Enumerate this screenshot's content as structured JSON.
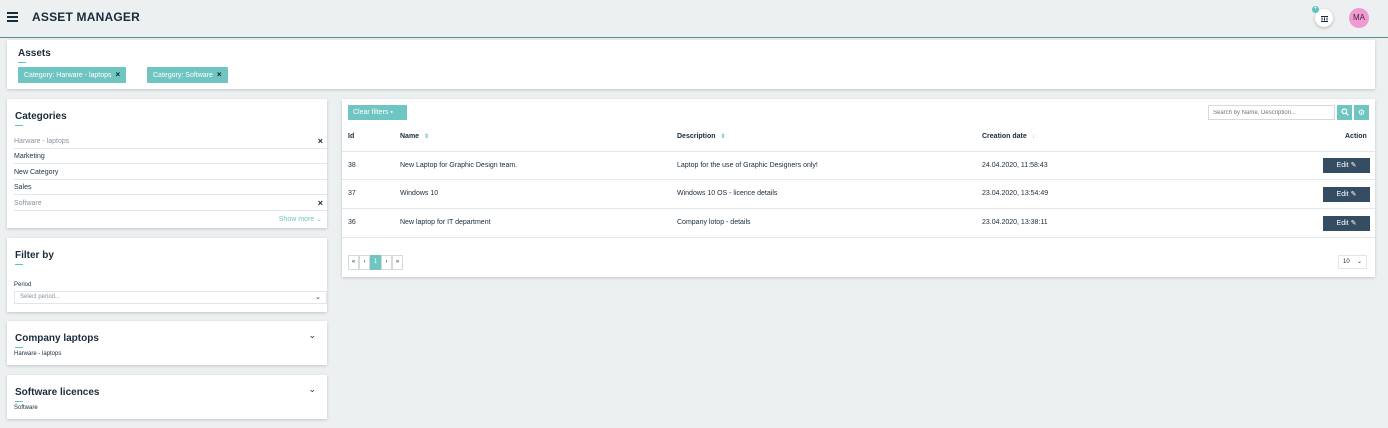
{
  "header": {
    "app_title": "ASSET MANAGER",
    "avatar_initials": "MA",
    "avatar_color": "#ef9bd0",
    "accent_color": "#6fc5c2"
  },
  "assets": {
    "title": "Assets",
    "chips": [
      {
        "label": "Category: Harware - laptops"
      },
      {
        "label": "Category: Software"
      }
    ]
  },
  "categories": {
    "title": "Categories",
    "items": [
      {
        "label": "Harware - laptops",
        "selected": true
      },
      {
        "label": "Marketing",
        "selected": false
      },
      {
        "label": "New Category",
        "selected": false
      },
      {
        "label": "Sales",
        "selected": false
      },
      {
        "label": "Software",
        "selected": true
      }
    ],
    "show_more": "Show more"
  },
  "filter": {
    "title": "Filter by",
    "period_label": "Period",
    "period_placeholder": "Select period..."
  },
  "saved_filters": [
    {
      "title": "Company laptops",
      "subtitle": "Harware - laptops"
    },
    {
      "title": "Software licences",
      "subtitle": "Software"
    }
  ],
  "table": {
    "clear_filters": "Clear filters",
    "search_placeholder": "Search by Name, Description...",
    "columns": {
      "id": "Id",
      "name": "Name",
      "description": "Description",
      "created": "Creation date",
      "action": "Action"
    },
    "rows": [
      {
        "id": "38",
        "name": "New Laptop for Graphic Design team.",
        "description": "Laptop for the use of Graphic Designers only!",
        "created": "24.04.2020, 11:58:43"
      },
      {
        "id": "37",
        "name": "Windows 10",
        "description": "Windows 10 OS - licence details",
        "created": "23.04.2020, 13:54:49"
      },
      {
        "id": "36",
        "name": "New laptop for IT department",
        "description": "Company lotop - details",
        "created": "23.04.2020, 13:38:11"
      }
    ],
    "edit_label": "Edit",
    "pager": {
      "first": "«",
      "prev": "‹",
      "current": "1",
      "next": "›",
      "last": "»"
    },
    "page_size": "10"
  }
}
